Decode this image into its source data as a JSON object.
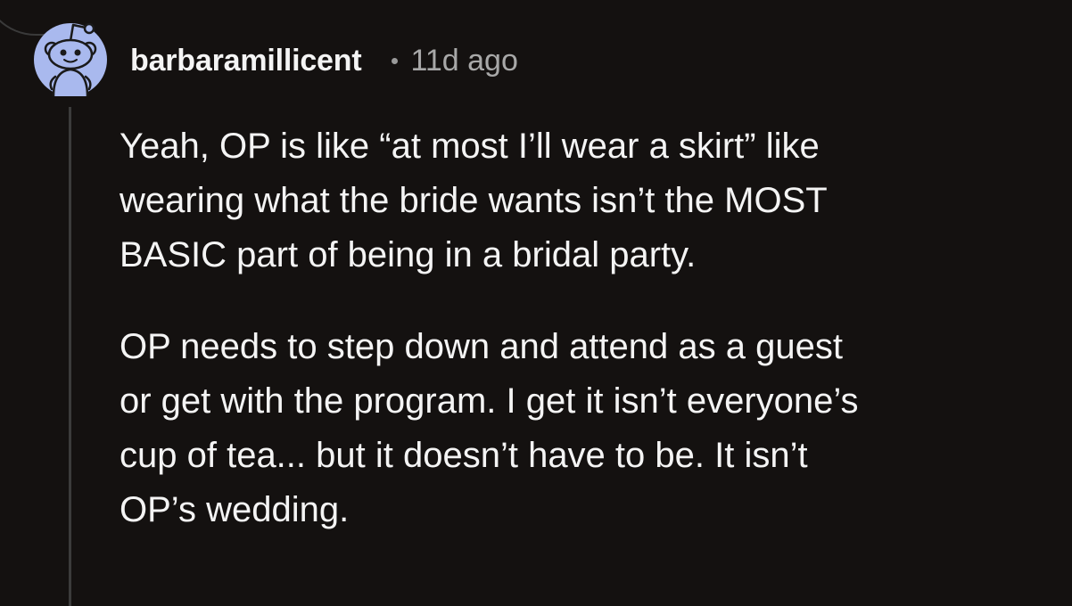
{
  "comment": {
    "author": "barbaramillicent",
    "separator_icon": "dot-separator-icon",
    "timestamp": "11d ago",
    "avatar_icon": "snoo-avatar-icon",
    "paragraphs": [
      {
        "lines": [
          "Yeah, OP is like “at most I’ll wear a skirt” like",
          "wearing what the bride wants isn’t the MOST",
          "BASIC part of being in a bridal party."
        ]
      },
      {
        "lines": [
          "OP needs to step down and attend as a guest",
          "or get with the program. I get it isn’t everyone’s",
          "cup of tea... but it doesn’t have to be. It isn’t",
          "OP’s wedding."
        ]
      }
    ]
  },
  "colors": {
    "background": "#141110",
    "avatar_bg": "#a9b9ee",
    "text": "#f4f4f4",
    "muted": "#a8a8a8"
  }
}
